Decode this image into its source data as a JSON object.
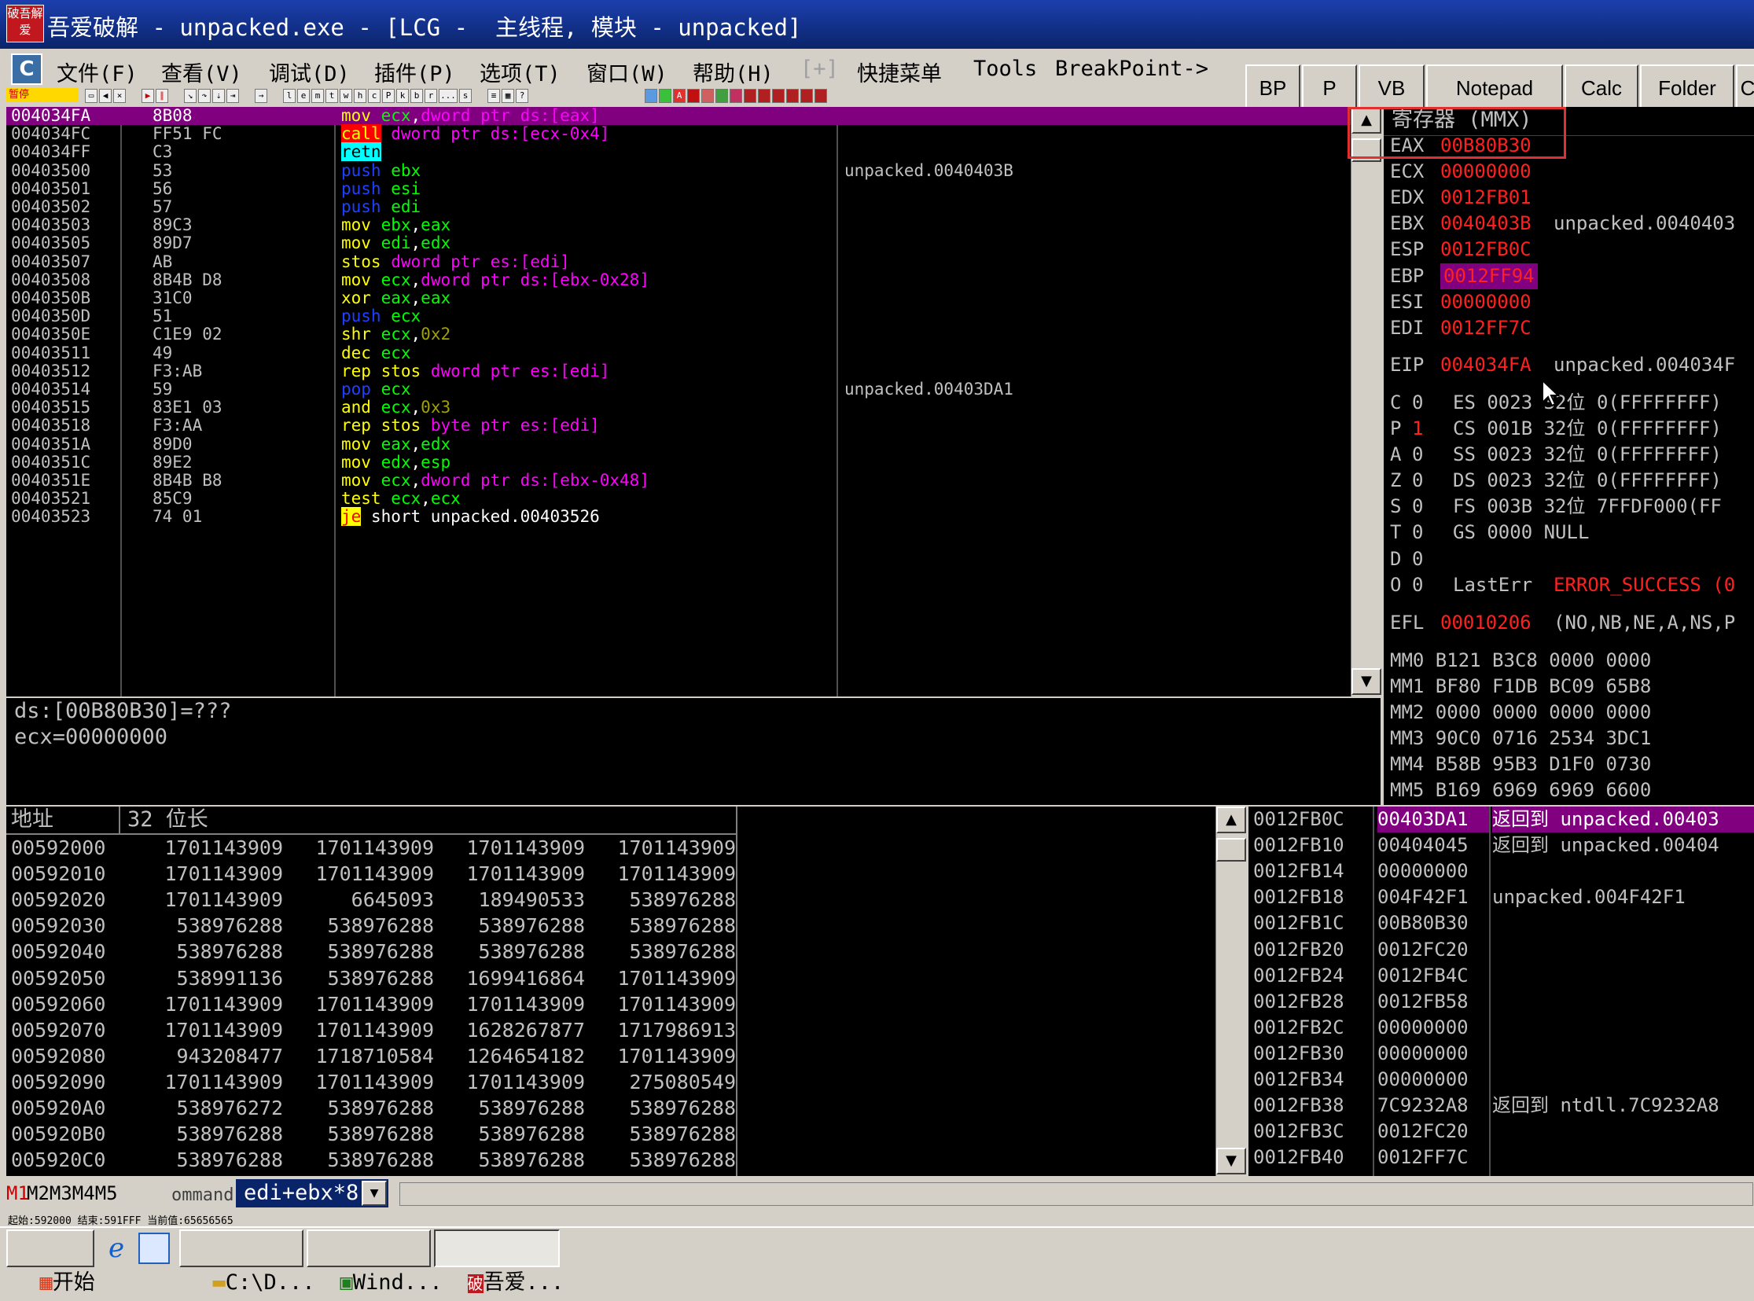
{
  "window": {
    "logo_text": "破吾解爱",
    "title": "吾爱破解 - unpacked.exe - [LCG -  主线程, 模块 - unpacked]"
  },
  "menu": [
    "文件(F)",
    "查看(V)",
    "调试(D)",
    "插件(P)",
    "选项(T)",
    "窗口(W)",
    "帮助(H)",
    "[+]",
    "快捷菜单",
    "Tools",
    "BreakPoint->"
  ],
  "quick_buttons": [
    "BP",
    "P",
    "VB",
    "Notepad",
    "Calc",
    "Folder",
    "C"
  ],
  "toolbar": {
    "pause_label": "暂停",
    "letters": [
      "l",
      "e",
      "m",
      "t",
      "w",
      "h",
      "c",
      "P",
      "k",
      "b",
      "r",
      "...",
      "s"
    ]
  },
  "disasm": [
    {
      "addr": "004034FA",
      "hex": "8B08",
      "parts": [
        [
          "y",
          "mov "
        ],
        [
          "gr",
          "ecx"
        ],
        [
          "w",
          ","
        ],
        [
          "m",
          "dword ptr ds:[eax]"
        ]
      ],
      "comment": "",
      "selected": true
    },
    {
      "addr": "004034FC",
      "hex": "FF51 FC",
      "parts": [
        [
          "call",
          "call"
        ],
        [
          "w",
          " "
        ],
        [
          "m",
          "dword ptr ds:[ecx-0x4]"
        ]
      ],
      "comment": ""
    },
    {
      "addr": "004034FF",
      "hex": "C3",
      "parts": [
        [
          "retn",
          "retn"
        ]
      ],
      "comment": ""
    },
    {
      "addr": "00403500",
      "hex": "53",
      "parts": [
        [
          "b",
          "push "
        ],
        [
          "gr",
          "ebx"
        ]
      ],
      "comment": "unpacked.0040403B"
    },
    {
      "addr": "00403501",
      "hex": "56",
      "parts": [
        [
          "b",
          "push "
        ],
        [
          "gr",
          "esi"
        ]
      ],
      "comment": ""
    },
    {
      "addr": "00403502",
      "hex": "57",
      "parts": [
        [
          "b",
          "push "
        ],
        [
          "gr",
          "edi"
        ]
      ],
      "comment": ""
    },
    {
      "addr": "00403503",
      "hex": "89C3",
      "parts": [
        [
          "y",
          "mov "
        ],
        [
          "gr",
          "ebx"
        ],
        [
          "w",
          ","
        ],
        [
          "gr",
          "eax"
        ]
      ],
      "comment": ""
    },
    {
      "addr": "00403505",
      "hex": "89D7",
      "parts": [
        [
          "y",
          "mov "
        ],
        [
          "gr",
          "edi"
        ],
        [
          "w",
          ","
        ],
        [
          "gr",
          "edx"
        ]
      ],
      "comment": ""
    },
    {
      "addr": "00403507",
      "hex": "AB",
      "parts": [
        [
          "y",
          "stos "
        ],
        [
          "m",
          "dword ptr es:[edi]"
        ]
      ],
      "comment": ""
    },
    {
      "addr": "00403508",
      "hex": "8B4B D8",
      "parts": [
        [
          "y",
          "mov "
        ],
        [
          "gr",
          "ecx"
        ],
        [
          "w",
          ","
        ],
        [
          "m",
          "dword ptr ds:[ebx-0x28]"
        ]
      ],
      "comment": ""
    },
    {
      "addr": "0040350B",
      "hex": "31C0",
      "parts": [
        [
          "y",
          "xor "
        ],
        [
          "gr",
          "eax"
        ],
        [
          "w",
          ","
        ],
        [
          "gr",
          "eax"
        ]
      ],
      "comment": ""
    },
    {
      "addr": "0040350D",
      "hex": "51",
      "parts": [
        [
          "b",
          "push "
        ],
        [
          "gr",
          "ecx"
        ]
      ],
      "comment": ""
    },
    {
      "addr": "0040350E",
      "hex": "C1E9 02",
      "parts": [
        [
          "y",
          "shr "
        ],
        [
          "gr",
          "ecx"
        ],
        [
          "w",
          ","
        ],
        [
          "ol",
          "0x2"
        ]
      ],
      "comment": ""
    },
    {
      "addr": "00403511",
      "hex": "49",
      "parts": [
        [
          "y",
          "dec "
        ],
        [
          "gr",
          "ecx"
        ]
      ],
      "comment": ""
    },
    {
      "addr": "00403512",
      "hex": "F3:AB",
      "parts": [
        [
          "y",
          "rep stos "
        ],
        [
          "m",
          "dword ptr es:[edi]"
        ]
      ],
      "comment": ""
    },
    {
      "addr": "00403514",
      "hex": "59",
      "parts": [
        [
          "b",
          "pop "
        ],
        [
          "gr",
          "ecx"
        ]
      ],
      "comment": "unpacked.00403DA1"
    },
    {
      "addr": "00403515",
      "hex": "83E1 03",
      "parts": [
        [
          "y",
          "and "
        ],
        [
          "gr",
          "ecx"
        ],
        [
          "w",
          ","
        ],
        [
          "ol",
          "0x3"
        ]
      ],
      "comment": ""
    },
    {
      "addr": "00403518",
      "hex": "F3:AA",
      "parts": [
        [
          "y",
          "rep stos "
        ],
        [
          "m",
          "byte ptr es:[edi]"
        ]
      ],
      "comment": ""
    },
    {
      "addr": "0040351A",
      "hex": "89D0",
      "parts": [
        [
          "y",
          "mov "
        ],
        [
          "gr",
          "eax"
        ],
        [
          "w",
          ","
        ],
        [
          "gr",
          "edx"
        ]
      ],
      "comment": ""
    },
    {
      "addr": "0040351C",
      "hex": "89E2",
      "parts": [
        [
          "y",
          "mov "
        ],
        [
          "gr",
          "edx"
        ],
        [
          "w",
          ","
        ],
        [
          "gr",
          "esp"
        ]
      ],
      "comment": ""
    },
    {
      "addr": "0040351E",
      "hex": "8B4B B8",
      "parts": [
        [
          "y",
          "mov "
        ],
        [
          "gr",
          "ecx"
        ],
        [
          "w",
          ","
        ],
        [
          "m",
          "dword ptr ds:[ebx-0x48]"
        ]
      ],
      "comment": ""
    },
    {
      "addr": "00403521",
      "hex": "85C9",
      "parts": [
        [
          "y",
          "test "
        ],
        [
          "gr",
          "ecx"
        ],
        [
          "w",
          ","
        ],
        [
          "gr",
          "ecx"
        ]
      ],
      "comment": ""
    },
    {
      "addr": "00403523",
      "hex": "74 01",
      "parts": [
        [
          "je",
          "je"
        ],
        [
          "w",
          " short unpacked.00403526"
        ]
      ],
      "comment": ""
    }
  ],
  "info": [
    "ds:[00B80B30]=???",
    "ecx=00000000"
  ],
  "registers": {
    "header": "寄存器 (MMX)",
    "gp": [
      {
        "name": "EAX",
        "value": "00B80B30",
        "note": ""
      },
      {
        "name": "ECX",
        "value": "00000000",
        "note": ""
      },
      {
        "name": "EDX",
        "value": "0012FB01",
        "note": ""
      },
      {
        "name": "EBX",
        "value": "0040403B",
        "note": "unpacked.0040403"
      },
      {
        "name": "ESP",
        "value": "0012FB0C",
        "note": ""
      },
      {
        "name": "EBP",
        "value": "0012FF94",
        "note": "",
        "hl": true
      },
      {
        "name": "ESI",
        "value": "00000000",
        "note": ""
      },
      {
        "name": "EDI",
        "value": "0012FF7C",
        "note": ""
      }
    ],
    "eip": {
      "name": "EIP",
      "value": "004034FA",
      "note": "unpacked.004034F"
    },
    "flags": [
      {
        "f": "C",
        "v": "0",
        "seg": "ES 0023 32位 0(FFFFFFFF)"
      },
      {
        "f": "P",
        "v": "1",
        "seg": "CS 001B 32位 0(FFFFFFFF)",
        "red": true
      },
      {
        "f": "A",
        "v": "0",
        "seg": "SS 0023 32位 0(FFFFFFFF)"
      },
      {
        "f": "Z",
        "v": "0",
        "seg": "DS 0023 32位 0(FFFFFFFF)"
      },
      {
        "f": "S",
        "v": "0",
        "seg": "FS 003B 32位 7FFDF000(FF"
      },
      {
        "f": "T",
        "v": "0",
        "seg": "GS 0000 NULL"
      },
      {
        "f": "D",
        "v": "0",
        "seg": ""
      },
      {
        "f": "O",
        "v": "0",
        "seg": "LastErr",
        "err": "ERROR_SUCCESS (0"
      }
    ],
    "efl": {
      "name": "EFL",
      "value": "00010206",
      "note": "(NO,NB,NE,A,NS,P"
    },
    "mmx": [
      "MM0 B121 B3C8 0000 0000",
      "MM1 BF80 F1DB BC09 65B8",
      "MM2 0000 0000 0000 0000",
      "MM3 90C0 0716 2534 3DC1",
      "MM4 B58B 95B3 D1F0 0730",
      "MM5 B169 6969 6969 6600"
    ]
  },
  "dump": {
    "col_addr": "地址",
    "col_data": "32 位长",
    "rows": [
      {
        "addr": "00592000",
        "v": [
          "1701143909",
          "1701143909",
          "1701143909",
          "1701143909"
        ]
      },
      {
        "addr": "00592010",
        "v": [
          "1701143909",
          "1701143909",
          "1701143909",
          "1701143909"
        ]
      },
      {
        "addr": "00592020",
        "v": [
          "1701143909",
          "6645093",
          "189490533",
          "538976288"
        ]
      },
      {
        "addr": "00592030",
        "v": [
          "538976288",
          "538976288",
          "538976288",
          "538976288"
        ]
      },
      {
        "addr": "00592040",
        "v": [
          "538976288",
          "538976288",
          "538976288",
          "538976288"
        ]
      },
      {
        "addr": "00592050",
        "v": [
          "538991136",
          "538976288",
          "1699416864",
          "1701143909"
        ]
      },
      {
        "addr": "00592060",
        "v": [
          "1701143909",
          "1701143909",
          "1701143909",
          "1701143909"
        ]
      },
      {
        "addr": "00592070",
        "v": [
          "1701143909",
          "1701143909",
          "1628267877",
          "1717986913"
        ]
      },
      {
        "addr": "00592080",
        "v": [
          "943208477",
          "1718710584",
          "1264654182",
          "1701143909"
        ]
      },
      {
        "addr": "00592090",
        "v": [
          "1701143909",
          "1701143909",
          "1701143909",
          "275080549"
        ]
      },
      {
        "addr": "005920A0",
        "v": [
          "538976272",
          "538976288",
          "538976288",
          "538976288"
        ]
      },
      {
        "addr": "005920B0",
        "v": [
          "538976288",
          "538976288",
          "538976288",
          "538976288"
        ]
      },
      {
        "addr": "005920C0",
        "v": [
          "538976288",
          "538976288",
          "538976288",
          "538976288"
        ]
      }
    ]
  },
  "stack": [
    {
      "addr": "0012FB0C",
      "val": "00403DA1",
      "note": "返回到 unpacked.00403",
      "selected": true
    },
    {
      "addr": "0012FB10",
      "val": "00404045",
      "note": "返回到 unpacked.00404"
    },
    {
      "addr": "0012FB14",
      "val": "00000000",
      "note": ""
    },
    {
      "addr": "0012FB18",
      "val": "004F42F1",
      "note": "unpacked.004F42F1"
    },
    {
      "addr": "0012FB1C",
      "val": "00B80B30",
      "note": ""
    },
    {
      "addr": "0012FB20",
      "val": "0012FC20",
      "note": ""
    },
    {
      "addr": "0012FB24",
      "val": "0012FB4C",
      "note": ""
    },
    {
      "addr": "0012FB28",
      "val": "0012FB58",
      "note": ""
    },
    {
      "addr": "0012FB2C",
      "val": "00000000",
      "note": ""
    },
    {
      "addr": "0012FB30",
      "val": "00000000",
      "note": ""
    },
    {
      "addr": "0012FB34",
      "val": "00000000",
      "note": ""
    },
    {
      "addr": "0012FB38",
      "val": "7C9232A8",
      "note": "返回到 ntdll.7C9232A8"
    },
    {
      "addr": "0012FB3C",
      "val": "0012FC20",
      "note": ""
    },
    {
      "addr": "0012FB40",
      "val": "0012FF7C",
      "note": ""
    }
  ],
  "dump_tabs": {
    "first": "M1",
    "rest": "M2M3M4M5",
    "cmd_hint": "ommand"
  },
  "command": {
    "value": "edi+ebx*8"
  },
  "status_line": "起始:592000 结束:591FFF 当前值:65656565",
  "taskbar": {
    "start": "开始",
    "tasks": [
      "C:\\D...",
      "Wind...",
      "吾爱..."
    ]
  }
}
